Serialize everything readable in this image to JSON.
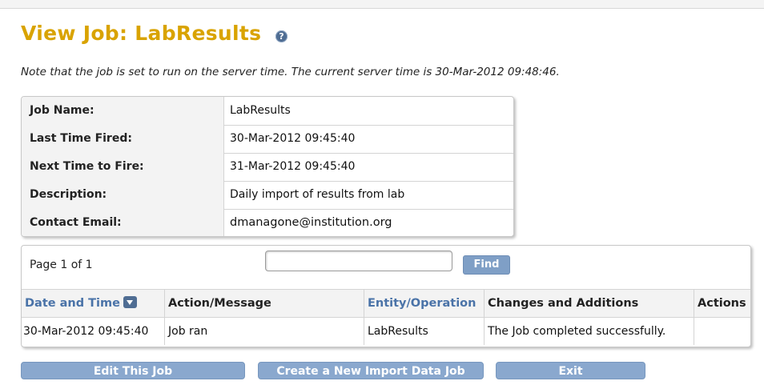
{
  "header": {
    "title": "View Job: LabResults",
    "help_glyph": "?",
    "help_icon": "help-icon"
  },
  "note": "Note that the job is set to run on the server time. The current server time is 30-Mar-2012 09:48:46.",
  "job_info": {
    "rows": [
      {
        "label": "Job Name:",
        "value": "LabResults"
      },
      {
        "label": "Last Time Fired:",
        "value": "30-Mar-2012 09:45:40"
      },
      {
        "label": "Next Time to Fire:",
        "value": "31-Mar-2012 09:45:40"
      },
      {
        "label": "Description:",
        "value": "Daily import of results from lab"
      },
      {
        "label": "Contact Email:",
        "value": "dmanagone@institution.org"
      }
    ]
  },
  "log": {
    "page_info": "Page 1 of 1",
    "search_value": "",
    "find_label": "Find",
    "columns": [
      "Date and Time",
      "Action/Message",
      "Entity/Operation",
      "Changes and Additions",
      "Actions"
    ],
    "sort_icon": "sort-descending-icon",
    "rows": [
      {
        "date": "30-Mar-2012 09:45:40",
        "action": "Job ran",
        "entity": "LabResults",
        "changes": "The Job completed successfully.",
        "actions": ""
      }
    ]
  },
  "buttons": {
    "edit": "Edit This Job",
    "create": "Create a New Import Data Job",
    "exit": "Exit"
  },
  "colors": {
    "title": "#d9a300",
    "link": "#4a73a8",
    "button": "#8aa8ce"
  }
}
